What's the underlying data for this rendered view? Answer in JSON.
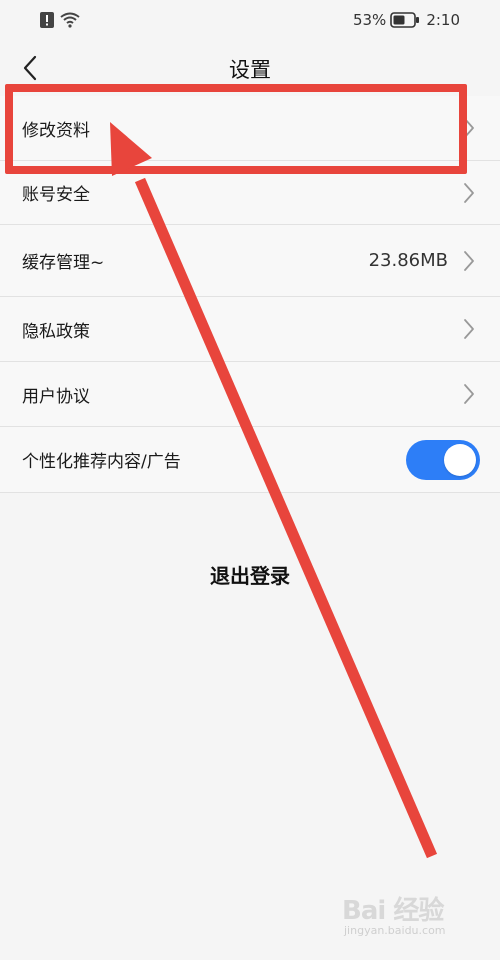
{
  "status_bar": {
    "battery_percent": "53%",
    "time": "2:10",
    "icons": [
      "alert-icon",
      "wifi-icon",
      "battery-icon"
    ]
  },
  "header": {
    "title": "设置",
    "back_icon": "chevron-left-icon"
  },
  "settings": [
    {
      "label": "修改资料",
      "value": "",
      "control": "chevron"
    },
    {
      "label": "账号安全",
      "value": "",
      "control": "chevron"
    },
    {
      "label": "缓存管理~",
      "value": "23.86MB",
      "control": "chevron"
    },
    {
      "label": "隐私政策",
      "value": "",
      "control": "chevron"
    },
    {
      "label": "用户协议",
      "value": "",
      "control": "chevron"
    },
    {
      "label": "个性化推荐内容/广告",
      "value": "",
      "control": "toggle",
      "toggle_on": true
    }
  ],
  "logout": {
    "label": "退出登录"
  },
  "colors": {
    "accent": "#2d7ef7",
    "annotation": "#e8453c",
    "background": "#f5f5f5"
  },
  "watermark": {
    "logo": "Bai 经验",
    "sub": "jingyan.baidu.com"
  }
}
